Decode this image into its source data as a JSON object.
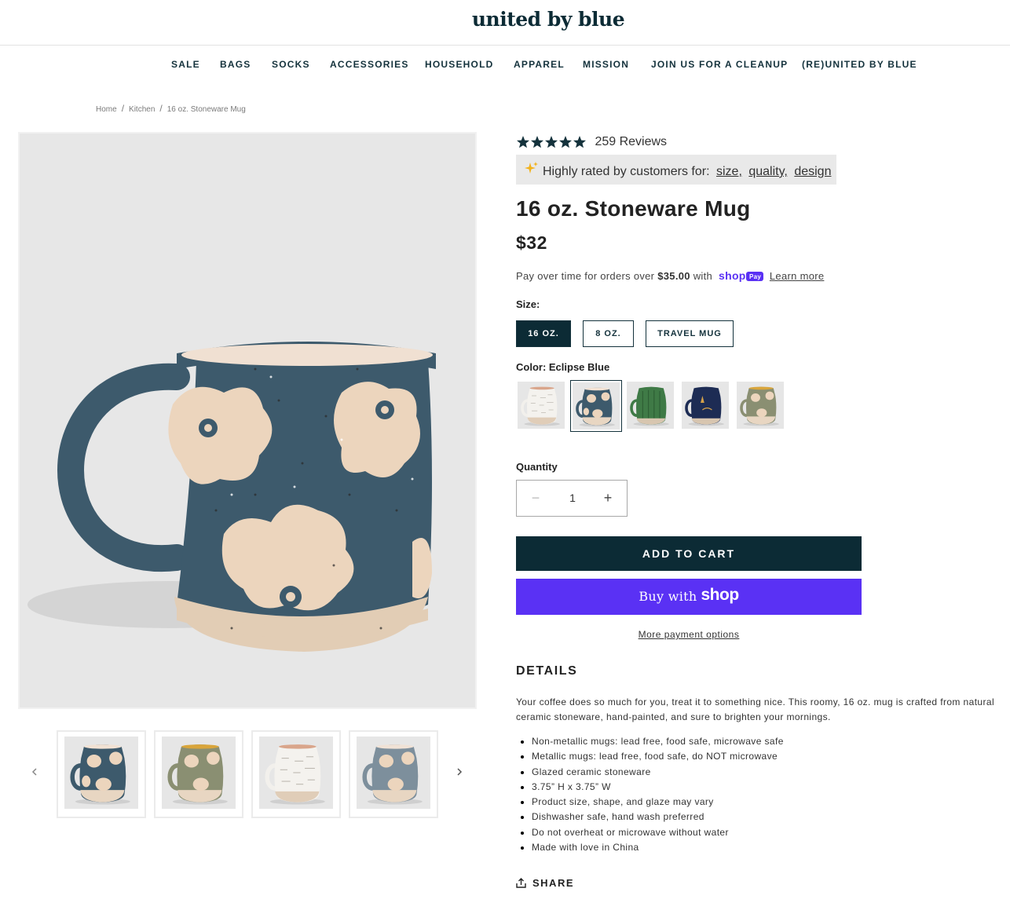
{
  "brand": {
    "logo_text": "united by blue"
  },
  "nav": {
    "items": [
      "SALE",
      "BAGS",
      "SOCKS",
      "ACCESSORIES",
      "HOUSEHOLD",
      "APPAREL",
      "MISSION",
      "JOIN US FOR A CLEANUP",
      "(RE)UNITED BY BLUE"
    ]
  },
  "breadcrumb": {
    "home": "Home",
    "category": "Kitchen",
    "current": "16 oz. Stoneware Mug",
    "separator": "/"
  },
  "gallery": {
    "thumbnail_colors": [
      "Eclipse Blue",
      "Olive",
      "White",
      "Slate Blue"
    ],
    "prev_icon": "chevron-left-icon",
    "next_icon": "chevron-right-icon"
  },
  "product": {
    "rating": 5,
    "reviews_label": "259 Reviews",
    "highlight_prefix": "Highly rated by customers for:",
    "highlight_tags": [
      "size,",
      "quality,",
      "design"
    ],
    "title": "16 oz. Stoneware Mug",
    "price": "$32",
    "installments_prefix": "Pay over time for orders over",
    "installments_amount": "$35.00",
    "installments_with": "with",
    "learn_more": "Learn more",
    "size_label": "Size:",
    "sizes": [
      "16 OZ.",
      "8 OZ.",
      "TRAVEL MUG"
    ],
    "selected_size": "16 OZ.",
    "color_label": "Color: Eclipse Blue",
    "color_swatches": [
      "White",
      "Eclipse Blue",
      "Green",
      "Navy",
      "Olive"
    ],
    "quantity_label": "Quantity",
    "quantity": "1",
    "add_to_cart": "ADD TO CART",
    "buy_with": "Buy with",
    "shop_word": "shop",
    "more_payment": "More payment options",
    "details_heading": "DETAILS",
    "description": "Your coffee does so much for you, treat it to something nice. This roomy, 16 oz. mug is crafted from natural ceramic stoneware, hand-painted, and sure to brighten your mornings.",
    "details_list": [
      "Non-metallic mugs: lead free, food safe, microwave safe",
      "Metallic mugs: lead free, food safe, do NOT microwave",
      "Glazed ceramic stoneware",
      "3.75” H x 3.75” W",
      "Product size, shape, and glaze may vary",
      "Dishwasher safe, hand wash preferred",
      "Do not overheat or microwave without water",
      "Made with love in China"
    ],
    "share_label": "SHARE"
  },
  "colors": {
    "brand_dark": "#0c2b35",
    "shop_pay_purple": "#5a31f4",
    "mug_blue": "#3d5a6c",
    "mug_cream": "#ecd5bd"
  }
}
